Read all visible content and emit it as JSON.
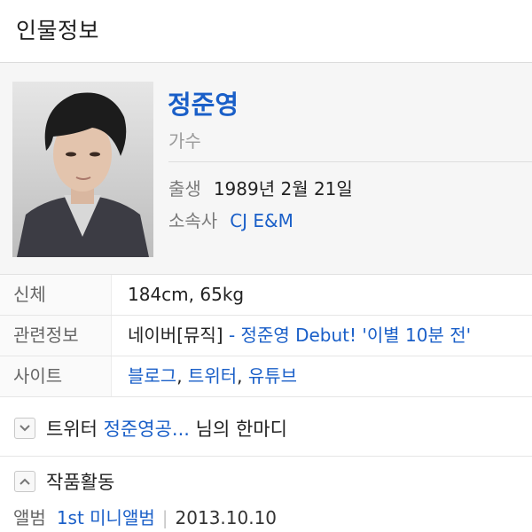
{
  "header": {
    "title": "인물정보"
  },
  "profile": {
    "name": "정준영",
    "occupation": "가수",
    "birth_label": "출생",
    "birth_value": "1989년 2월 21일",
    "agency_label": "소속사",
    "agency_value": "CJ E&M"
  },
  "details": {
    "body_label": "신체",
    "body_value": "184cm, 65kg",
    "related_label": "관련정보",
    "related_source": "네이버[뮤직]",
    "related_dash": " - ",
    "related_link": "정준영 Debut! '이별 10분 전'",
    "site_label": "사이트",
    "site_links": [
      "블로그",
      "트위터",
      "유튜브"
    ],
    "site_sep": ", "
  },
  "twitter": {
    "prefix": "트위터 ",
    "handle": "정준영공...",
    "suffix": " 님의 한마디",
    "toggle_icon": "chevron-down-icon"
  },
  "works": {
    "title": "작품활동",
    "toggle_icon": "chevron-up-icon",
    "album_label": "앨범",
    "album_link": "1st 미니앨범",
    "separator": "|",
    "album_date": "2013.10.10"
  },
  "colors": {
    "link": "#1a5fc8",
    "muted": "#9a9a9a",
    "profile_bg": "#f6f6f6"
  }
}
